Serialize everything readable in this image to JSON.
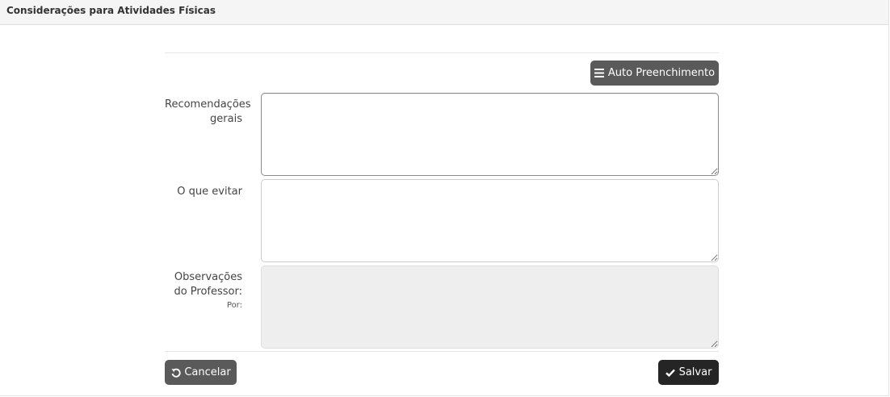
{
  "header": {
    "title": "Considerações para Atividades Físicas"
  },
  "toolbar": {
    "auto_fill_label": "Auto Preenchimento",
    "auto_fill_icon": "bars-icon"
  },
  "fields": {
    "recommendations": {
      "label_line1": "Recomendações",
      "label_line2": "gerais",
      "value": ""
    },
    "avoid": {
      "label": "O que evitar",
      "value": ""
    },
    "observations": {
      "label_line1": "Observações",
      "label_line2": "do Professor:",
      "sub_label": "Por:",
      "value": ""
    }
  },
  "actions": {
    "cancel_label": "Cancelar",
    "cancel_icon": "undo-icon",
    "save_label": "Salvar",
    "save_icon": "check-icon"
  },
  "colors": {
    "gray_button": "#5a5a5a",
    "dark_button": "#252525",
    "readonly_bg": "#eeeeee"
  }
}
